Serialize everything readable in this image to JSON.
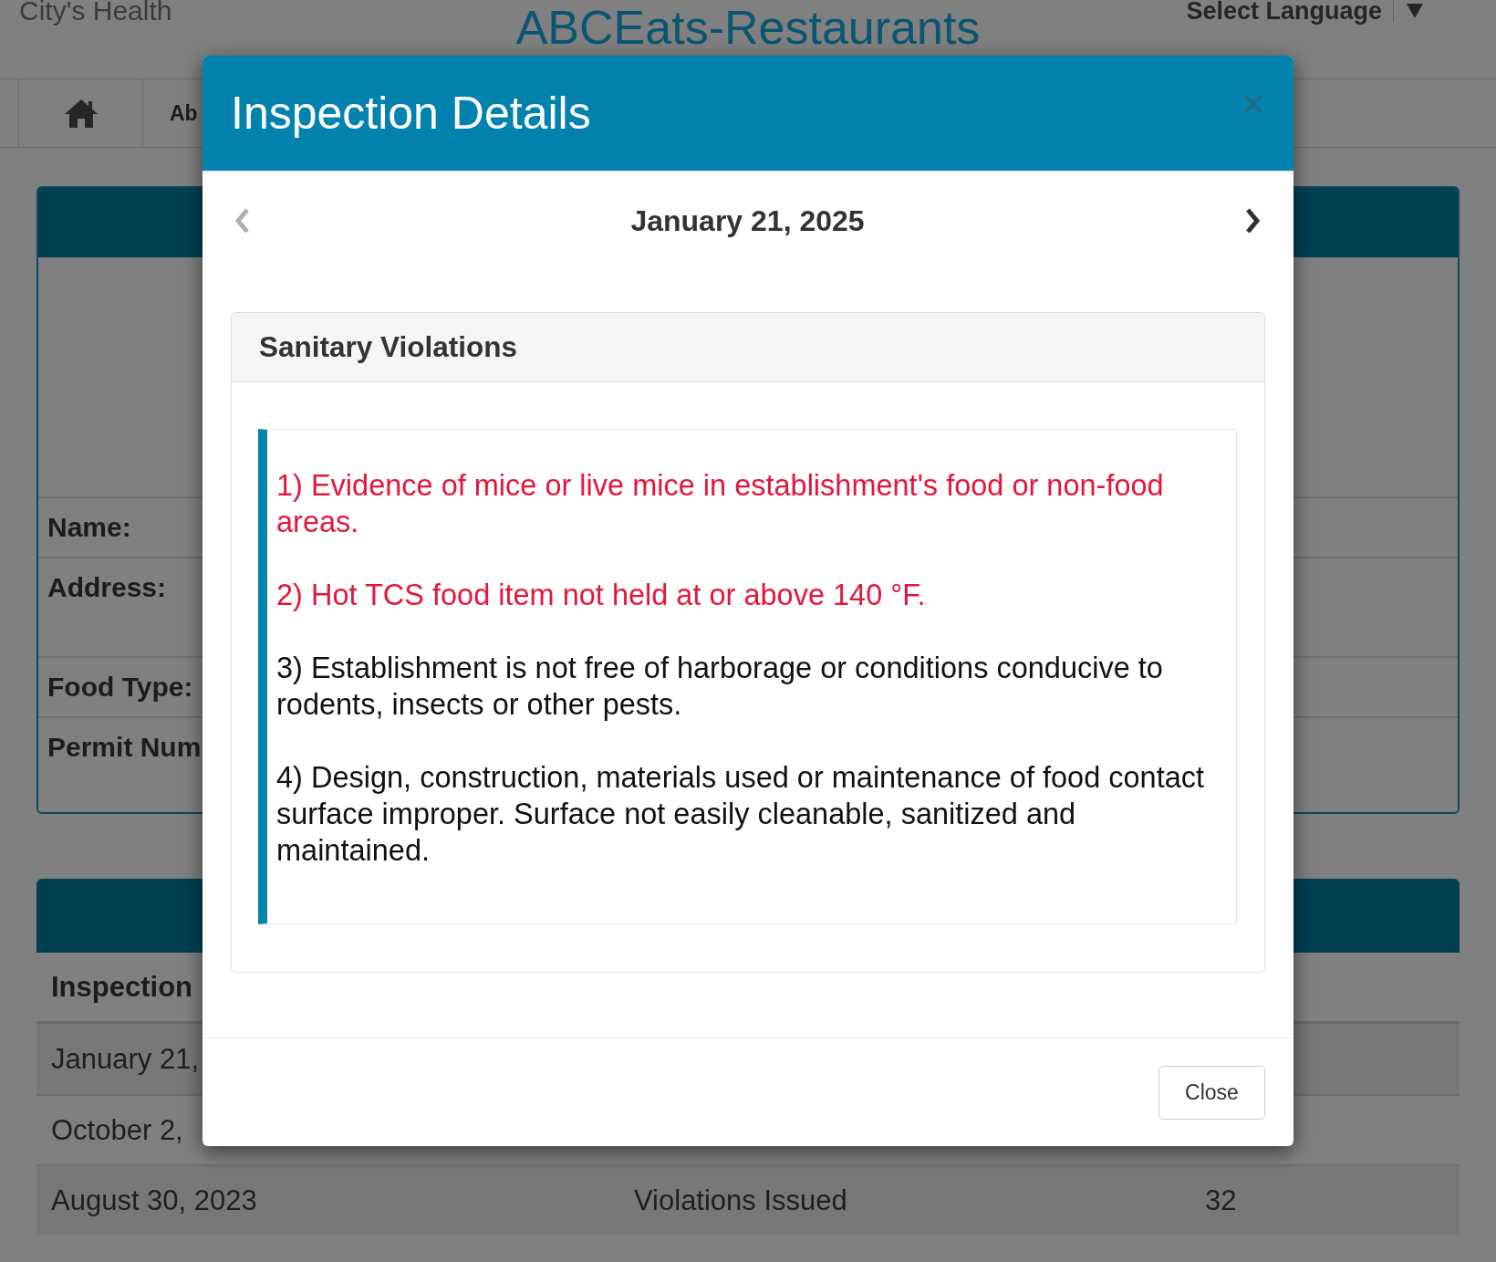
{
  "site_header": {
    "tagline": "City's Health",
    "language_select": {
      "label": "Select Language"
    },
    "title": "ABCEats-Restaurants"
  },
  "nav": {
    "links": [
      "Ab"
    ]
  },
  "restaurant_card": {
    "fields": [
      "Name:",
      "Address:",
      "Food Type:",
      "Permit Num"
    ]
  },
  "inspections_card": {
    "columns": [
      "Inspection"
    ],
    "rows": [
      {
        "cells": [
          "January 21,"
        ]
      },
      {
        "cells": [
          "October 2,"
        ]
      },
      {
        "cells": [
          "August 30, 2023",
          "Violations Issued",
          "32"
        ]
      }
    ]
  },
  "modal": {
    "title": "Inspection Details",
    "date_nav": {
      "date": "January 21, 2025",
      "previous": {
        "disabled": true
      },
      "next": {
        "disabled": false
      }
    },
    "panel": {
      "heading": "Sanitary Violations",
      "violations": [
        {
          "text": "1) Evidence of mice or live mice in establishment's food or non-food areas.",
          "critical": true
        },
        {
          "text": "2) Hot TCS food item not held at or above 140 °F.",
          "critical": true
        },
        {
          "text": "3) Establishment is not free of harborage or conditions conducive to rodents, insects or other pests.",
          "critical": false
        },
        {
          "text": "4) Design, construction, materials used or maintenance of food contact surface improper. Surface not easily cleanable, sanitized and maintained.",
          "critical": false
        }
      ]
    },
    "footer_button": "Close"
  }
}
